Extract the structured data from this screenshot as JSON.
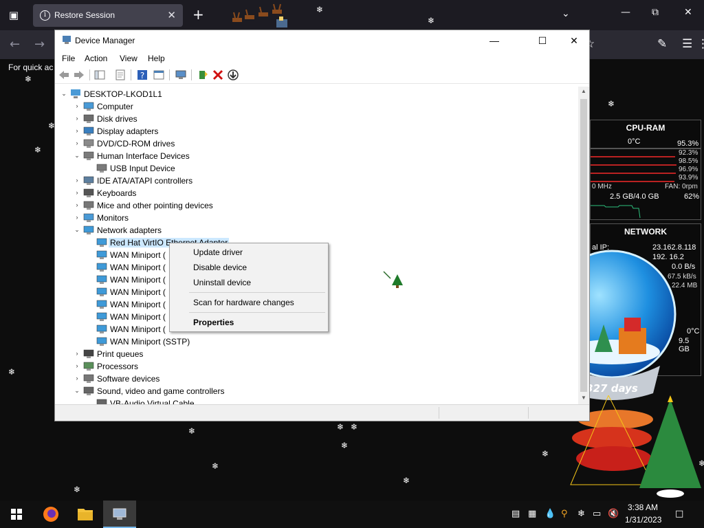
{
  "browser": {
    "tab_title": "Restore Session",
    "bookmarks_hint": "For quick ac"
  },
  "device_manager": {
    "title": "Device Manager",
    "menu": [
      "File",
      "Action",
      "View",
      "Help"
    ],
    "computer_name": "DESKTOP-LKOD1L1",
    "tree": [
      {
        "label": "Computer",
        "expanded": false,
        "icon": "monitor-icon"
      },
      {
        "label": "Disk drives",
        "expanded": false,
        "icon": "disk-icon"
      },
      {
        "label": "Display adapters",
        "expanded": false,
        "icon": "display-adapter-icon"
      },
      {
        "label": "DVD/CD-ROM drives",
        "expanded": false,
        "icon": "dvd-icon"
      },
      {
        "label": "Human Interface Devices",
        "expanded": true,
        "icon": "hid-icon"
      },
      {
        "label": "USB Input Device",
        "child": true,
        "icon": "hid-icon"
      },
      {
        "label": "IDE ATA/ATAPI controllers",
        "expanded": false,
        "icon": "ide-icon"
      },
      {
        "label": "Keyboards",
        "expanded": false,
        "icon": "keyboard-icon"
      },
      {
        "label": "Mice and other pointing devices",
        "expanded": false,
        "icon": "mouse-icon"
      },
      {
        "label": "Monitors",
        "expanded": false,
        "icon": "monitor-icon"
      },
      {
        "label": "Network adapters",
        "expanded": true,
        "icon": "network-icon"
      },
      {
        "label": "Red Hat VirtIO Ethernet Adapter",
        "child": true,
        "selected": true,
        "icon": "network-icon"
      },
      {
        "label": "WAN Miniport (",
        "child": true,
        "icon": "network-icon"
      },
      {
        "label": "WAN Miniport (",
        "child": true,
        "icon": "network-icon"
      },
      {
        "label": "WAN Miniport (",
        "child": true,
        "icon": "network-icon"
      },
      {
        "label": "WAN Miniport (",
        "child": true,
        "icon": "network-icon"
      },
      {
        "label": "WAN Miniport (",
        "child": true,
        "icon": "network-icon"
      },
      {
        "label": "WAN Miniport (",
        "child": true,
        "icon": "network-icon"
      },
      {
        "label": "WAN Miniport (",
        "child": true,
        "icon": "network-icon"
      },
      {
        "label": "WAN Miniport (SSTP)",
        "child": true,
        "icon": "network-icon"
      },
      {
        "label": "Print queues",
        "expanded": false,
        "icon": "printer-icon"
      },
      {
        "label": "Processors",
        "expanded": false,
        "icon": "processor-icon"
      },
      {
        "label": "Software devices",
        "expanded": false,
        "icon": "software-icon"
      },
      {
        "label": "Sound, video and game controllers",
        "expanded": true,
        "icon": "speaker-icon"
      },
      {
        "label": "VB-Audio Virtual Cable",
        "child": true,
        "icon": "speaker-icon"
      }
    ]
  },
  "context_menu": {
    "items": [
      "Update driver",
      "Disable device",
      "Uninstall device",
      "Scan for hardware changes",
      "Properties"
    ]
  },
  "cpu_widget": {
    "title": "CPU-RAM",
    "temp": "0°C",
    "total": "95.3%",
    "cores": [
      "92.3%",
      "98.5%",
      "96.9%",
      "93.9%"
    ],
    "freq": "0 MHz",
    "fan": "FAN: 0rpm",
    "ram": "2.5 GB/4.0 GB",
    "ram_pct": "62%"
  },
  "net_widget": {
    "title": "NETWORK",
    "ip_label": "al IP:",
    "ip": "23.162.8.118",
    "ip2": "192.  16.2",
    "speed": "0.0 B/s",
    "up": "67.5 kB/s",
    "total": "22.4 MB",
    "disk_temp": "0°C",
    "disk": "9.5 GB"
  },
  "snowglobe": {
    "days": "327 days"
  },
  "taskbar": {
    "time": "3:38 AM",
    "date": "1/31/2023"
  }
}
